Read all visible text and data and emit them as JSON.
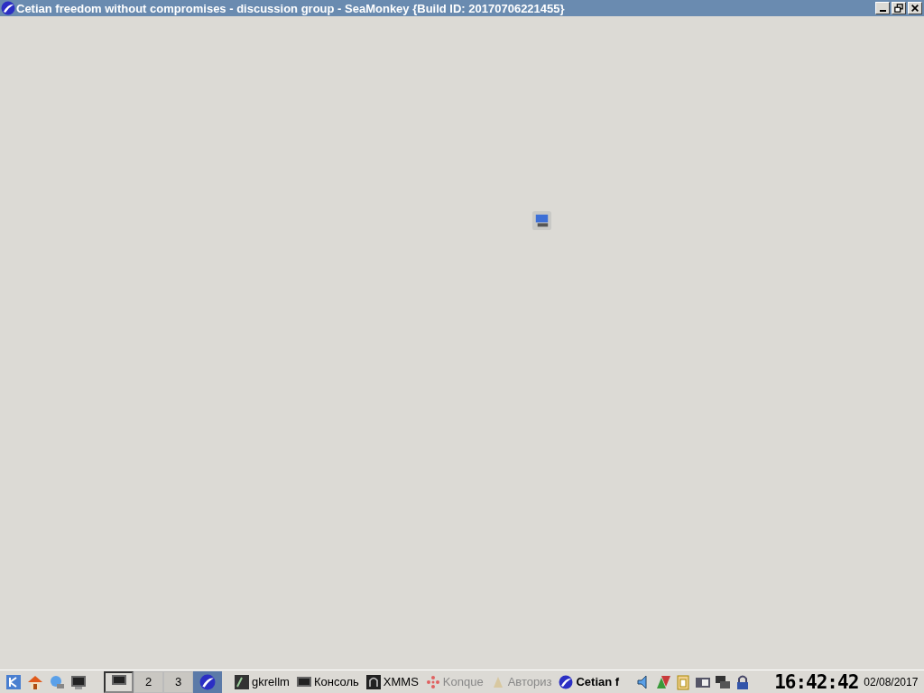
{
  "window": {
    "title": "Cetian freedom without compromises - discussion group - SeaMonkey {Build ID: 20170706221455}",
    "controls": [
      {
        "kind": "minimize"
      },
      {
        "kind": "restore"
      },
      {
        "kind": "close"
      }
    ]
  },
  "panel": {
    "launchers": [
      {
        "kind": "kde"
      },
      {
        "kind": "home"
      },
      {
        "kind": "network"
      },
      {
        "kind": "terminal"
      }
    ],
    "desktops": [
      {
        "selected": true
      },
      {
        "label": "2",
        "selected": false
      },
      {
        "label": "3",
        "selected": false
      }
    ],
    "tasks": [
      {
        "label": "gkrellm",
        "kind": "gkrellm",
        "selected": false,
        "dimmed": false
      },
      {
        "label": "Консоль",
        "kind": "terminal",
        "selected": false,
        "dimmed": false
      },
      {
        "label": "XMMS",
        "kind": "xmms",
        "selected": false,
        "dimmed": false
      },
      {
        "label": "Konque",
        "kind": "konqueror",
        "selected": false,
        "dimmed": true
      },
      {
        "label": "Авториз",
        "kind": "auth",
        "selected": false,
        "dimmed": true
      },
      {
        "label": "Cetian f",
        "kind": "seamonkey",
        "selected": true,
        "dimmed": false
      }
    ],
    "tray": [
      {
        "kind": "speaker"
      },
      {
        "kind": "arrows"
      },
      {
        "kind": "klipper"
      },
      {
        "kind": "battery"
      },
      {
        "kind": "network"
      },
      {
        "kind": "lock"
      }
    ],
    "clock": "16:42:42",
    "date": "02/08/2017"
  }
}
